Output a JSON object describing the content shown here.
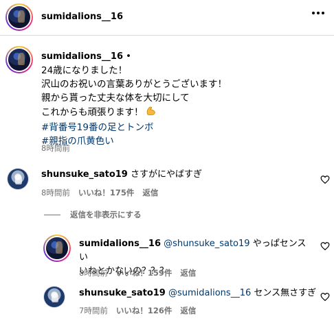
{
  "post": {
    "username": "sumidalions__16",
    "caption_lines": [
      "24歳になりました！",
      "沢山のお祝いの言葉ありがとうございます！",
      "親から貰った丈夫な体を大切にして",
      "これからも頑張ります！"
    ],
    "emoji": "flexed-biceps",
    "hashtags": [
      "#背番号19番の足とトンボ",
      "#親指の爪黄色い"
    ],
    "time": "8時間前",
    "separator": "•"
  },
  "comments": [
    {
      "username": "shunsuke_sato19",
      "text": "さすがにやばすぎ",
      "time": "8時間前",
      "likes": "いいね！175件",
      "reply_label": "返信"
    }
  ],
  "hide_replies_label": "返信を非表示にする",
  "replies": [
    {
      "username": "sumidalions__16",
      "mention": "@shunsuke_sato19",
      "text_line1": "やっぱセンスい",
      "text_line2": "いねとかないの？？？",
      "time": "8時間前",
      "likes": "いいね！159件",
      "reply_label": "返信"
    },
    {
      "username": "shunsuke_sato19",
      "mention": "@sumidalions__16",
      "text": "センス無さすぎ",
      "time": "7時間前",
      "likes": "いいね！126件",
      "reply_label": "返信"
    }
  ],
  "colors": {
    "hashtag": "#00376b",
    "meta": "#737373",
    "divider": "#dbdbdb"
  }
}
